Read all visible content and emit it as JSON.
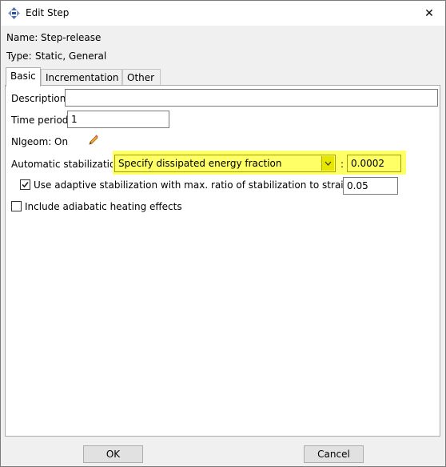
{
  "window": {
    "title": "Edit Step",
    "close_symbol": "✕"
  },
  "name": {
    "label": "Name:",
    "value": "Step-release"
  },
  "type": {
    "label": "Type:",
    "value": "Static, General"
  },
  "tabs": [
    {
      "label": "Basic",
      "active": true
    },
    {
      "label": "Incrementation",
      "active": false
    },
    {
      "label": "Other",
      "active": false
    }
  ],
  "basic": {
    "description": {
      "label": "Description:",
      "value": ""
    },
    "time_period": {
      "label": "Time period:",
      "value": "1"
    },
    "nlgeom": {
      "label": "Nlgeom:",
      "value": "On"
    },
    "stabilization": {
      "label": "Automatic stabilization:",
      "selected": "Specify dissipated energy fraction",
      "separator": ":",
      "value": "0.0002"
    },
    "adaptive": {
      "checked": true,
      "label": "Use adaptive stabilization with max. ratio of stabilization to strain energy:",
      "value": "0.05"
    },
    "adiabatic": {
      "checked": false,
      "label": "Include adiabatic heating effects"
    }
  },
  "buttons": {
    "ok": "OK",
    "cancel": "Cancel"
  },
  "colors": {
    "highlight": "#ffff66",
    "window_bg": "#f0f0f0",
    "panel_bg": "#ffffff"
  }
}
